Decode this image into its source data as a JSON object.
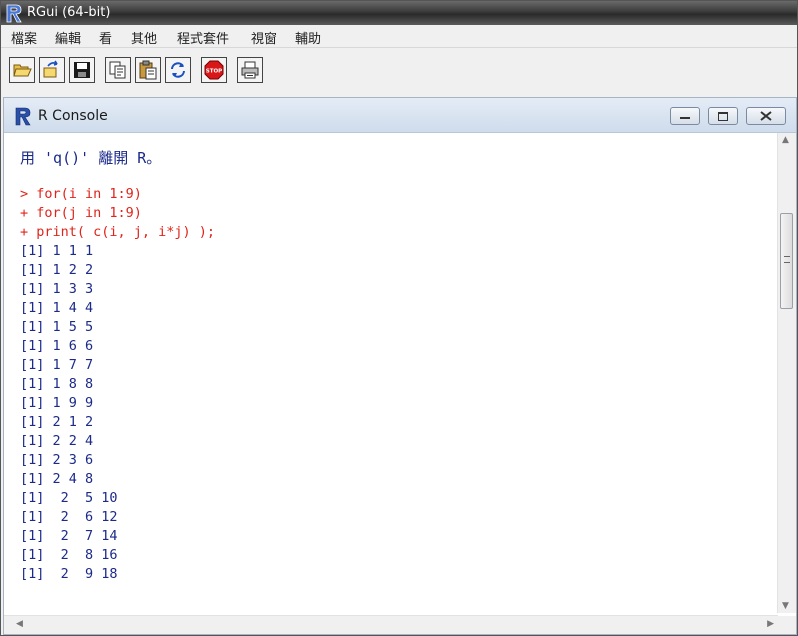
{
  "window": {
    "title": "RGui (64-bit)"
  },
  "menu": [
    {
      "label": "檔案"
    },
    {
      "label": "編輯"
    },
    {
      "label": "看"
    },
    {
      "label": "其他"
    },
    {
      "label": "程式套件"
    },
    {
      "label": "視窗"
    },
    {
      "label": "輔助"
    }
  ],
  "toolbar": [
    {
      "icon": "open-folder-icon"
    },
    {
      "icon": "load-workspace-icon"
    },
    {
      "icon": "save-icon"
    },
    {
      "icon": "copy-icon"
    },
    {
      "icon": "paste-icon"
    },
    {
      "icon": "refresh-icon"
    },
    {
      "icon": "stop-icon",
      "label": "STOP"
    },
    {
      "icon": "print-icon"
    }
  ],
  "console": {
    "title": "R Console",
    "lines": [
      {
        "text": "用 'q()' 離開 R。",
        "kind": "out"
      },
      {
        "text": "",
        "kind": "out"
      },
      {
        "text": "> for(i in 1:9)",
        "kind": "cmd"
      },
      {
        "text": "+ for(j in 1:9)",
        "kind": "cmd"
      },
      {
        "text": "+ print( c(i, j, i*j) );",
        "kind": "cmd"
      },
      {
        "text": "[1] 1 1 1",
        "kind": "out"
      },
      {
        "text": "[1] 1 2 2",
        "kind": "out"
      },
      {
        "text": "[1] 1 3 3",
        "kind": "out"
      },
      {
        "text": "[1] 1 4 4",
        "kind": "out"
      },
      {
        "text": "[1] 1 5 5",
        "kind": "out"
      },
      {
        "text": "[1] 1 6 6",
        "kind": "out"
      },
      {
        "text": "[1] 1 7 7",
        "kind": "out"
      },
      {
        "text": "[1] 1 8 8",
        "kind": "out"
      },
      {
        "text": "[1] 1 9 9",
        "kind": "out"
      },
      {
        "text": "[1] 2 1 2",
        "kind": "out"
      },
      {
        "text": "[1] 2 2 4",
        "kind": "out"
      },
      {
        "text": "[1] 2 3 6",
        "kind": "out"
      },
      {
        "text": "[1] 2 4 8",
        "kind": "out"
      },
      {
        "text": "[1]  2  5 10",
        "kind": "out"
      },
      {
        "text": "[1]  2  6 12",
        "kind": "out"
      },
      {
        "text": "[1]  2  7 14",
        "kind": "out"
      },
      {
        "text": "[1]  2  8 16",
        "kind": "out"
      },
      {
        "text": "[1]  2  9 18",
        "kind": "out"
      }
    ]
  },
  "colors": {
    "output": "#1c2a8a",
    "command": "#e0241b",
    "r_logo": "#2a4fa8"
  }
}
